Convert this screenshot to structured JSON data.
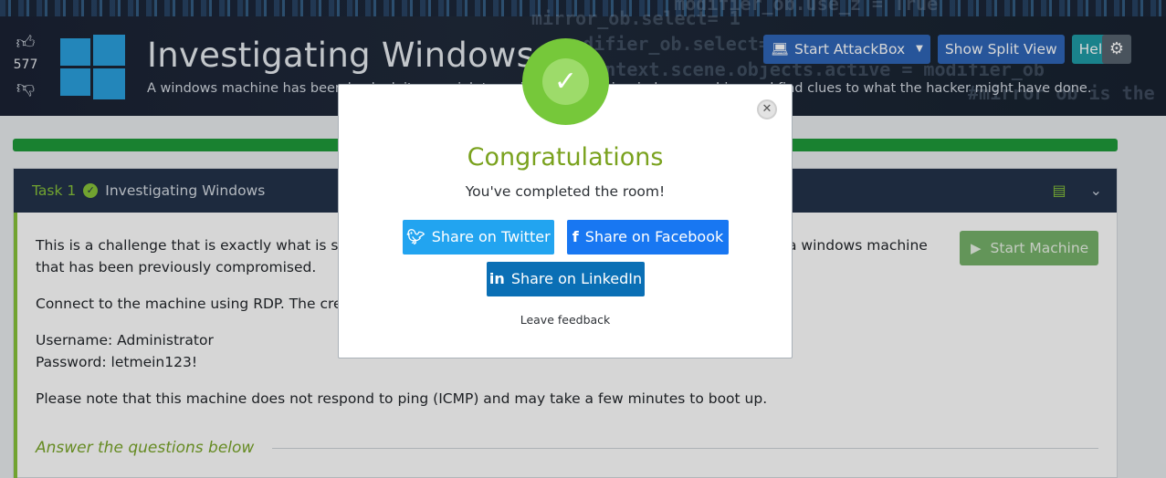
{
  "header": {
    "vote_count": "577",
    "title": "Investigating Windows",
    "description": "A windows machine has been hacked, its your job to go investigate this windows machine and find clues to what the hacker might have done.",
    "buttons": {
      "attackbox": "Start AttackBox",
      "split_view": "Show Split View",
      "help": "Help"
    },
    "background_code": [
      "    modifier_ob.use_z = True",
      "mirror_ob.select= 1",
      "  modifier_ob.select=1",
      "bpy.context.scene.objects.active = modifier_ob",
      "#mirror ob is the"
    ]
  },
  "progress": {
    "percent": 100,
    "color": "#1e9a3a"
  },
  "task": {
    "number": "Task 1",
    "title": "Investigating Windows",
    "paragraphs": {
      "p1": "This is a challenge that is exactly what is says on the tin, there are a few challenges around investigating a windows machine that has been previously compromised.",
      "p2": "Connect to the machine using RDP. The credentials the machine are as follows:",
      "p3a": "Username: Administrator",
      "p3b": "Password: letmein123!",
      "p4": "Please note that this machine does not respond to ping (ICMP) and may take a few minutes to boot up."
    },
    "start_machine": "Start Machine",
    "answer_heading": "Answer the questions below"
  },
  "modal": {
    "title": "Congratulations",
    "subtitle": "You've completed the room!",
    "share_twitter": "Share on Twitter",
    "share_facebook": "Share on Facebook",
    "share_linkedin": "Share on LinkedIn",
    "leave_feedback": "Leave feedback"
  },
  "colors": {
    "accent_green": "#87c33a",
    "twitter": "#22a4f0",
    "facebook": "#1877f2",
    "linkedin": "#0a6fb5"
  }
}
